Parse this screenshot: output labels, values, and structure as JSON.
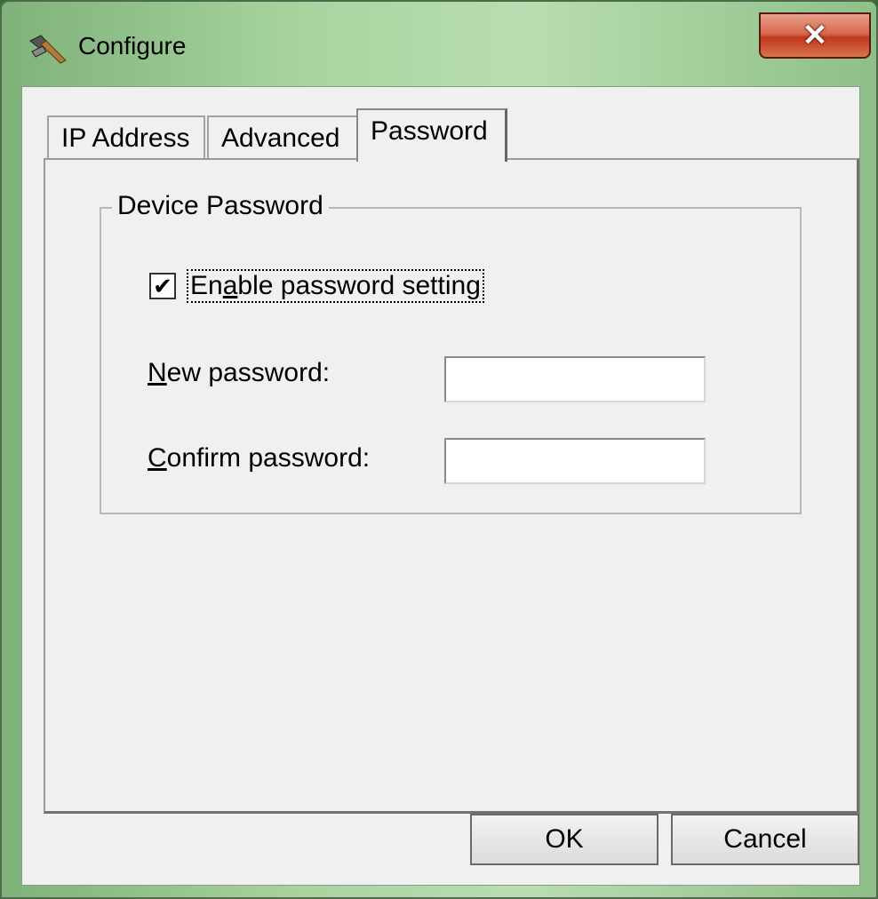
{
  "window": {
    "title": "Configure",
    "close_glyph": "✕",
    "icon": "hammer-icon"
  },
  "tabs": [
    {
      "label": "IP Address",
      "selected": false
    },
    {
      "label": "Advanced",
      "selected": false
    },
    {
      "label": "Password",
      "selected": true
    }
  ],
  "password_tab": {
    "group_title": "Device Password",
    "enable_checkbox": {
      "label_accel": "a",
      "label_pre": "En",
      "label_post": "ble password setting",
      "checked": true,
      "check_glyph": "✔"
    },
    "new_password": {
      "label_accel": "N",
      "label_rest": "ew password:",
      "value": ""
    },
    "confirm_password": {
      "label_accel": "C",
      "label_rest": "onfirm password:",
      "value": ""
    }
  },
  "buttons": {
    "ok": "OK",
    "cancel": "Cancel"
  },
  "colors": {
    "titlebar": "#a9d4a0",
    "close_button": "#c1391c",
    "client_background": "#f0f0f0"
  }
}
